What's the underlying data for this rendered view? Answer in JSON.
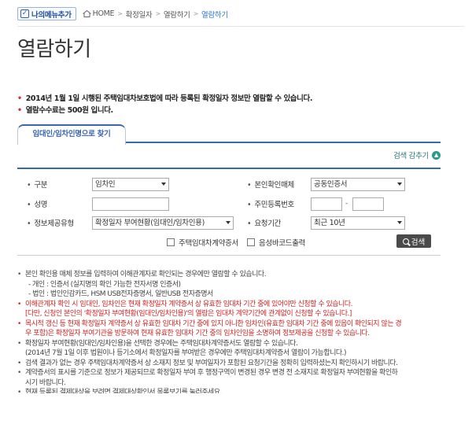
{
  "topbar": {
    "mymenu_label": "나의메뉴추가",
    "crumbs": [
      "HOME",
      "확정일자",
      "열람하기",
      "열람하기"
    ]
  },
  "page_title": "열람하기",
  "notice": [
    "2014년 1월 1일 시행된 주택임대차보호법에 따라 등록된 확정일자 정보만 열람할 수 있습니다.",
    "열람수수료는 500원 입니다."
  ],
  "tab": {
    "label": "임대인/임차인명으로 찾기"
  },
  "toggle": {
    "label": "검색 감추기"
  },
  "form": {
    "gubun_label": "구분",
    "gubun_value": "임차인",
    "verify_label": "본인확인매체",
    "verify_value": "공동인증서",
    "name_label": "성명",
    "jumin_label": "주민등록번호",
    "info_label": "정보제공유형",
    "info_value": "확정일자 부여현황(임대인/임차인용)",
    "period_label": "요청기간",
    "period_value": "최근 10년",
    "cb_contract": "주택임대차계약증서",
    "cb_barcode": "음성바코드출력",
    "search_button": "검색"
  },
  "guide": [
    {
      "text": "본인 확인용 매체 정보를 입력하여 이해관계자로 확인되는 경우에만 열람할 수 있습니다.",
      "style": "b"
    },
    {
      "text": "- 개인 : 인증서 (실지명의 확인 가능한 전자서명 인증서)",
      "style": "sub"
    },
    {
      "text": "- 법인 : 법인인감카드, HSM USB전자증명서, 일반USB 전자증명서",
      "style": "sub"
    },
    {
      "text": "이해관계자 확인 시 임대인, 임차인은 현재 확정일자 계약증서 상 유효한 임대차 기간 중에 있어야만 신청할 수 있습니다.",
      "style": "b red"
    },
    {
      "text": "[다만, 신청인 본인의 '확정일자 부여현황(임대인/임차인용)'의 열람은 임대차 계약기간에 관계없이 신청할 수 있습니다.]",
      "style": "red"
    },
    {
      "text": "목시적 갱신 등 현재 확정일자 계약증서 상 유효한 임대차 기간 중에 있지 아니한 임차인(유효한 임대차 기간 중에 있음이 확인되지 않는 경",
      "style": "b red"
    },
    {
      "text": "우 포함)은 확정일자 부여기관을 방문하여 현재 유효한 임대차 기간 중의 임차인임을 소명하여 정보제공을 신청할 수 있습니다.",
      "style": "red"
    },
    {
      "text": "확정일자 부여현황(임대인/임차인용)을 선택한 경우에는 주택임대차계약증서도 열람할 수 있습니다.",
      "style": "b"
    },
    {
      "text": "(2014년 7월 1일 이후 법원이나 등기소에서 확정일자를 부여받은 경우에만 주택임대차계약증서 열람이 가능합니다.)",
      "style": ""
    },
    {
      "text": "검색 결과가 없는 경우 주택임대차계약증서 상 소재지 정보 및 부여일자가 포함된 요청기간을 정확히 입력하셨는지 확인하시기 바랍니다.",
      "style": "b"
    },
    {
      "text": "계약증서의 표시를 기준으로 정보가 제공되므로 확정일자 부여 후 행정구역이 변경된 경우 변경 전 소재지로 확정일자 부여현황을 확인하",
      "style": "b"
    },
    {
      "text": "시기 바랍니다.",
      "style": ""
    },
    {
      "text": "현재 등록된 결제대상을 보려면 결제대상확인서 목록보기를 눌러주세요.",
      "style": "b cut"
    }
  ],
  "colors": {
    "accent": "#3a66b0",
    "red": "#d02424",
    "toggle": "#2a9a8a"
  }
}
